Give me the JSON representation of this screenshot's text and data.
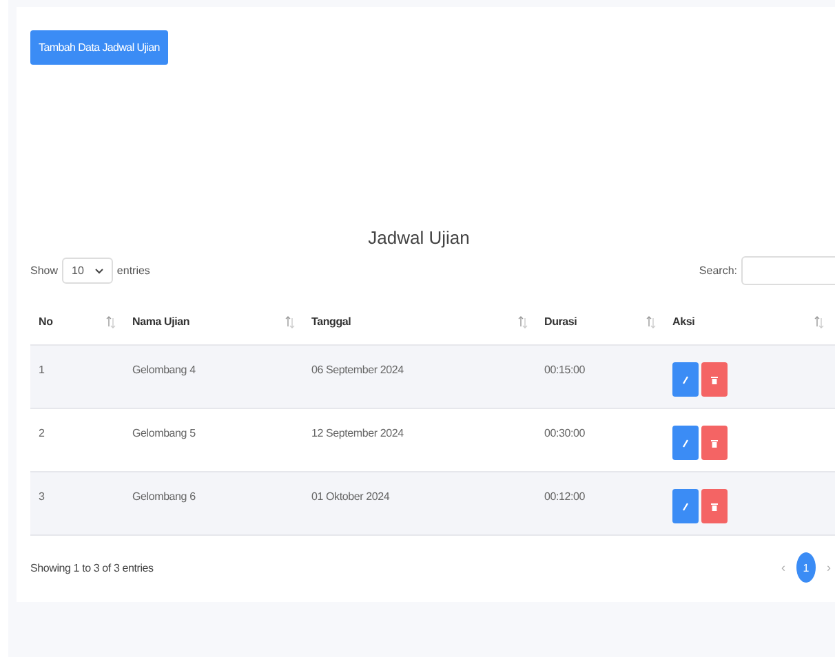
{
  "add_button": {
    "label": "Tambah Data Jadwal Ujian"
  },
  "table_title": "Jadwal Ujian",
  "length_control": {
    "prefix": "Show",
    "value": "10",
    "suffix": "entries"
  },
  "search": {
    "label": "Search:"
  },
  "table": {
    "columns": [
      "No",
      "Nama Ujian",
      "Tanggal",
      "Durasi",
      "Aksi"
    ],
    "rows": [
      {
        "cells": [
          "1",
          "Gelombang 4",
          "06 September 2024",
          "00:15:00"
        ]
      },
      {
        "cells": [
          "2",
          "Gelombang 5",
          "12 September 2024",
          "00:30:00"
        ]
      },
      {
        "cells": [
          "3",
          "Gelombang 6",
          "01 Oktober 2024",
          "00:12:00"
        ]
      }
    ]
  },
  "info": "Showing 1 to 3 of 3 entries",
  "pagination": {
    "previous": "‹",
    "pages": [
      {
        "label": "1",
        "selected": true
      }
    ],
    "next": "›"
  }
}
